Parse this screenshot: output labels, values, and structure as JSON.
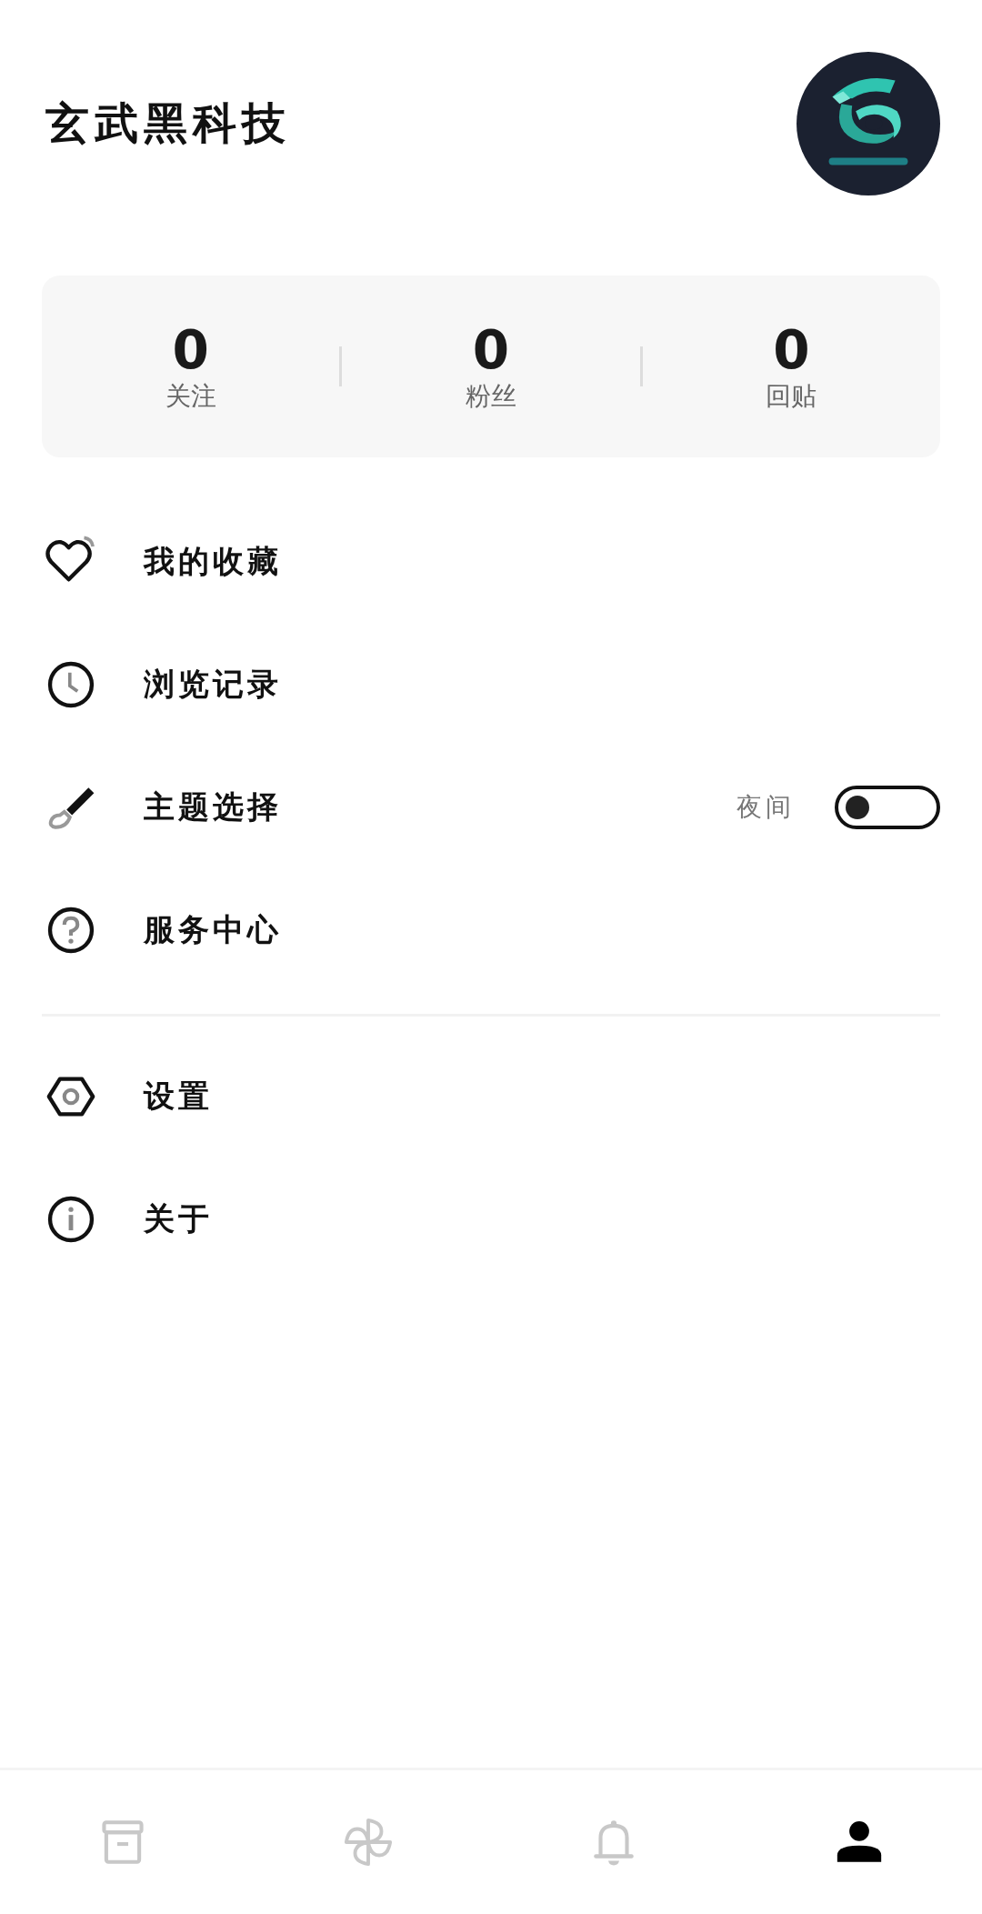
{
  "header": {
    "title": "玄武黑科技"
  },
  "stats": [
    {
      "value": "0",
      "label": "关注"
    },
    {
      "value": "0",
      "label": "粉丝"
    },
    {
      "value": "0",
      "label": "回贴"
    }
  ],
  "menu_groups": [
    [
      {
        "kind": "link",
        "label": "我的收藏"
      },
      {
        "kind": "link",
        "label": "浏览记录"
      },
      {
        "kind": "toggle",
        "label": "主题选择",
        "toggle_label": "夜间",
        "on": false
      },
      {
        "kind": "link",
        "label": "服务中心"
      }
    ],
    [
      {
        "kind": "link",
        "label": "设置"
      },
      {
        "kind": "link",
        "label": "关于"
      }
    ]
  ],
  "bottom_nav": [
    {
      "selected": false
    },
    {
      "selected": false
    },
    {
      "selected": false
    },
    {
      "selected": true
    }
  ]
}
